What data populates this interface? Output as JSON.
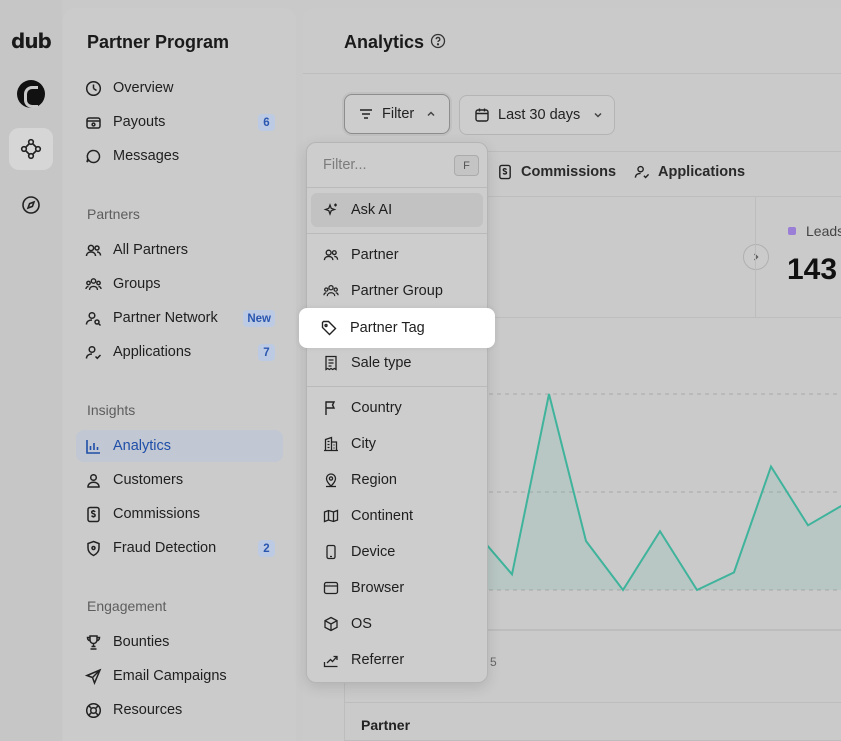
{
  "rail": {
    "logo": "dub",
    "items": [
      {
        "icon": "workspace-avatar"
      },
      {
        "icon": "partner-network-icon",
        "active": true
      },
      {
        "icon": "compass-icon"
      }
    ]
  },
  "sidebar": {
    "title": "Partner Program",
    "top_items": [
      {
        "label": "Overview",
        "icon": "overview-icon"
      },
      {
        "label": "Payouts",
        "icon": "payouts-icon",
        "badge": "6"
      },
      {
        "label": "Messages",
        "icon": "messages-icon"
      }
    ],
    "sections": [
      {
        "title": "Partners",
        "items": [
          {
            "label": "All Partners",
            "icon": "users-icon"
          },
          {
            "label": "Groups",
            "icon": "groups-icon"
          },
          {
            "label": "Partner Network",
            "icon": "user-search-icon",
            "badge": "New"
          },
          {
            "label": "Applications",
            "icon": "user-check-icon",
            "badge": "7"
          }
        ]
      },
      {
        "title": "Insights",
        "items": [
          {
            "label": "Analytics",
            "icon": "analytics-icon",
            "active": true
          },
          {
            "label": "Customers",
            "icon": "user-icon"
          },
          {
            "label": "Commissions",
            "icon": "dollar-receipt-icon"
          },
          {
            "label": "Fraud Detection",
            "icon": "shield-icon",
            "badge": "2"
          }
        ]
      },
      {
        "title": "Engagement",
        "items": [
          {
            "label": "Bounties",
            "icon": "trophy-icon"
          },
          {
            "label": "Email Campaigns",
            "icon": "send-icon"
          },
          {
            "label": "Resources",
            "icon": "lifebuoy-icon"
          }
        ]
      }
    ]
  },
  "main": {
    "title": "Analytics",
    "filter_label": "Filter",
    "date_label": "Last 30 days",
    "tabs": [
      {
        "label": "Commissions",
        "icon": "dollar-receipt-icon"
      },
      {
        "label": "Applications",
        "icon": "user-check-icon"
      }
    ],
    "stat": {
      "label": "Leads",
      "value": "143"
    },
    "x_tick": "5",
    "table_header": "Partner"
  },
  "dropdown": {
    "placeholder": "Filter...",
    "shortcut": "F",
    "ask_ai": "Ask AI",
    "group1": [
      {
        "label": "Partner",
        "icon": "users-icon"
      },
      {
        "label": "Partner Group",
        "icon": "groups-icon"
      },
      {
        "label": "Partner Tag",
        "icon": "tag-icon",
        "highlighted": true
      },
      {
        "label": "Sale type",
        "icon": "receipt-icon"
      }
    ],
    "group2": [
      {
        "label": "Country",
        "icon": "flag-icon"
      },
      {
        "label": "City",
        "icon": "building-icon"
      },
      {
        "label": "Region",
        "icon": "map-pin-icon"
      },
      {
        "label": "Continent",
        "icon": "globe-map-icon"
      },
      {
        "label": "Device",
        "icon": "mobile-icon"
      },
      {
        "label": "Browser",
        "icon": "browser-icon"
      },
      {
        "label": "OS",
        "icon": "cube-icon"
      },
      {
        "label": "Referrer",
        "icon": "referrer-icon"
      }
    ]
  },
  "colors": {
    "accent": "#1f4fa8",
    "chart_line": "#3fb39b",
    "badge_bg": "#bccbe3",
    "leads_dot": "#9b7ed6"
  },
  "chart_data": {
    "type": "area",
    "series": [
      {
        "values": [
          30,
          8,
          100,
          25,
          0,
          30,
          0,
          9,
          63,
          33,
          44
        ]
      }
    ]
  }
}
